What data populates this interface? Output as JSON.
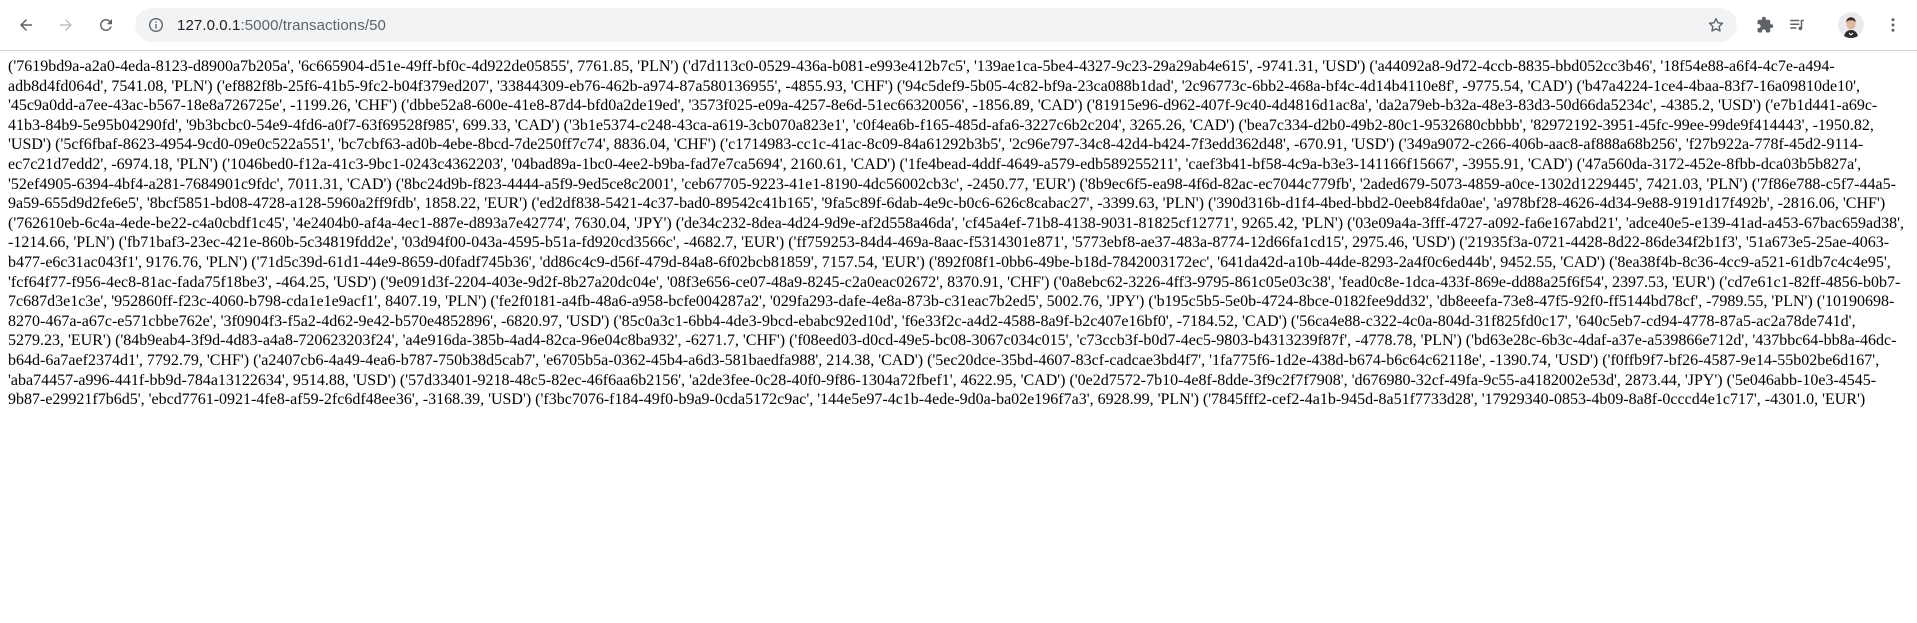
{
  "browser": {
    "url_host": "127.0.0.1",
    "url_path": ":5000/transactions/50",
    "icons": {
      "back": "arrow-left-icon",
      "forward": "arrow-right-icon",
      "reload": "reload-icon",
      "info": "info-icon",
      "star": "star-icon",
      "extensions": "puzzle-icon",
      "media": "media-control-icon",
      "menu": "kebab-menu-icon"
    }
  },
  "page": {
    "text": "('7619bd9a-a2a0-4eda-8123-d8900a7b205a', '6c665904-d51e-49ff-bf0c-4d922de05855', 7761.85, 'PLN') ('d7d113c0-0529-436a-b081-e993e412b7c5', '139ae1ca-5be4-4327-9c23-29a29ab4e615', -9741.31, 'USD') ('a44092a8-9d72-4ccb-8835-bbd052cc3b46', '18f54e88-a6f4-4c7e-a494-adb8d4fd064d', 7541.08, 'PLN') ('ef882f8b-25f6-41b5-9fc2-b04f379ed207', '33844309-eb76-462b-a974-87a580136955', -4855.93, 'CHF') ('94c5def9-5b05-4c82-bf9a-23ca088b1dad', '2c96773c-6bb2-468a-bf4c-4d14b4110e8f', -9775.54, 'CAD') ('b47a4224-1ce4-4baa-83f7-16a09810de10', '45c9a0dd-a7ee-43ac-b567-18e8a726725e', -1199.26, 'CHF') ('dbbe52a8-600e-41e8-87d4-bfd0a2de19ed', '3573f025-e09a-4257-8e6d-51ec66320056', -1856.89, 'CAD') ('81915e96-d962-407f-9c40-4d4816d1ac8a', 'da2a79eb-b32a-48e3-83d3-50d66da5234c', -4385.2, 'USD') ('e7b1d441-a69c-41b3-84b9-5e95b04290fd', '9b3bcbc0-54e9-4fd6-a0f7-63f69528f985', 699.33, 'CAD') ('3b1e5374-c248-43ca-a619-3cb070a823e1', 'c0f4ea6b-f165-485d-afa6-3227c6b2c204', 3265.26, 'CAD') ('bea7c334-d2b0-49b2-80c1-9532680cbbbb', '82972192-3951-45fc-99ee-99de9f414443', -1950.82, 'USD') ('5cf6fbaf-8623-4954-9cd0-09e0c522a551', 'bc7cbf63-ad0b-4ebe-8bcd-7de250ff7c74', 8836.04, 'CHF') ('c1714983-cc1c-41ac-8c09-84a61292b3b5', '2c96e797-34c8-42d4-b424-7f3edd362d48', -670.91, 'USD') ('349a9072-c266-406b-aac8-af888a68b256', 'f27b922a-778f-45d2-9114-ec7c21d7edd2', -6974.18, 'PLN') ('1046bed0-f12a-41c3-9bc1-0243c4362203', '04bad89a-1bc0-4ee2-b9ba-fad7e7ca5694', 2160.61, 'CAD') ('1fe4bead-4ddf-4649-a579-edb589255211', 'caef3b41-bf58-4c9a-b3e3-141166f15667', -3955.91, 'CAD') ('47a560da-3172-452e-8fbb-dca03b5b827a', '52ef4905-6394-4bf4-a281-7684901c9fdc', 7011.31, 'CAD') ('8bc24d9b-f823-4444-a5f9-9ed5ce8c2001', 'ceb67705-9223-41e1-8190-4dc56002cb3c', -2450.77, 'EUR') ('8b9ec6f5-ea98-4f6d-82ac-ec7044c779fb', '2aded679-5073-4859-a0ce-1302d1229445', 7421.03, 'PLN') ('7f86e788-c5f7-44a5-9a59-655d9d2fe6e5', '8bcf5851-bd08-4728-a128-5960a2ff9fdb', 1858.22, 'EUR') ('ed2df838-5421-4c37-bad0-89542c41b165', '9fa5c89f-6dab-4e9c-b0c6-626c8cabac27', -3399.63, 'PLN') ('390d316b-d1f4-4bed-bbd2-0eeb84fda0ae', 'a978bf28-4626-4d34-9e88-9191d17f492b', -2816.06, 'CHF') ('762610eb-6c4a-4ede-be22-c4a0cbdf1c45', '4e2404b0-af4a-4ec1-887e-d893a7e42774', 7630.04, 'JPY') ('de34c232-8dea-4d24-9d9e-af2d558a46da', 'cf45a4ef-71b8-4138-9031-81825cf12771', 9265.42, 'PLN') ('03e09a4a-3fff-4727-a092-fa6e167abd21', 'adce40e5-e139-41ad-a453-67bac659ad38', -1214.66, 'PLN') ('fb71baf3-23ec-421e-860b-5c34819fdd2e', '03d94f00-043a-4595-b51a-fd920cd3566c', -4682.7, 'EUR') ('ff759253-84d4-469a-8aac-f5314301e871', '5773ebf8-ae37-483a-8774-12d66fa1cd15', 2975.46, 'USD') ('21935f3a-0721-4428-8d22-86de34f2b1f3', '51a673e5-25ae-4063-b477-e6c31ac043f1', 9176.76, 'PLN') ('71d5c39d-61d1-44e9-8659-d0fadf745b36', 'dd86c4c9-d56f-479d-84a8-6f02bcb81859', 7157.54, 'EUR') ('892f08f1-0bb6-49be-b18d-7842003172ec', '641da42d-a10b-44de-8293-2a4f0c6ed44b', 9452.55, 'CAD') ('8ea38f4b-8c36-4cc9-a521-61db7c4c4e95', 'fcf64f77-f956-4ec8-81ac-fada75f18be3', -464.25, 'USD') ('9e091d3f-2204-403e-9d2f-8b27a20dc04e', '08f3e656-ce07-48a9-8245-c2a0eac02672', 8370.91, 'CHF') ('0a8ebc62-3226-4ff3-9795-861c05e03c38', 'fead0c8e-1dca-433f-869e-dd88a25f6f54', 2397.53, 'EUR') ('cd7e61c1-82ff-4856-b0b7-7c687d3e1c3e', '952860ff-f23c-4060-b798-cda1e1e9acf1', 8407.19, 'PLN') ('fe2f0181-a4fb-48a6-a958-bcfe004287a2', '029fa293-dafe-4e8a-873b-c31eac7b2ed5', 5002.76, 'JPY') ('b195c5b5-5e0b-4724-8bce-0182fee9dd32', 'db8eeefa-73e8-47f5-92f0-ff5144bd78cf', -7989.55, 'PLN') ('10190698-8270-467a-a67c-e571cbbe762e', '3f0904f3-f5a2-4d62-9e42-b570e4852896', -6820.97, 'USD') ('85c0a3c1-6bb4-4de3-9bcd-ebabc92ed10d', 'f6e33f2c-a4d2-4588-8a9f-b2c407e16bf0', -7184.52, 'CAD') ('56ca4e88-c322-4c0a-804d-31f825fd0c17', '640c5eb7-cd94-4778-87a5-ac2a78de741d', 5279.23, 'EUR') ('84b9eab4-3f9d-4d83-a4a8-720623203f24', 'a4e916da-385b-4ad4-82ca-96e04c8ba932', -6271.7, 'CHF') ('f08eed03-d0cd-49e5-bc08-3067c034c015', 'c73ccb3f-b0d7-4ec5-9803-b4313239f87f', -4778.78, 'PLN') ('bd63e28c-6b3c-4daf-a37e-a539866e712d', '437bbc64-bb8a-46dc-b64d-6a7aef2374d1', 7792.79, 'CHF') ('a2407cb6-4a49-4ea6-b787-750b38d5cab7', 'e6705b5a-0362-45b4-a6d3-581baedfa988', 214.38, 'CAD') ('5ec20dce-35bd-4607-83cf-cadcae3bd4f7', '1fa775f6-1d2e-438d-b674-b6c64c62118e', -1390.74, 'USD') ('f0ffb9f7-bf26-4587-9e14-55b02be6d167', 'aba74457-a996-441f-bb9d-784a13122634', 9514.88, 'USD') ('57d33401-9218-48c5-82ec-46f6aa6b2156', 'a2de3fee-0c28-40f0-9f86-1304a72fbef1', 4622.95, 'CAD') ('0e2d7572-7b10-4e8f-8dde-3f9c2f7f7908', 'd676980-32cf-49fa-9c55-a4182002e53d', 2873.44, 'JPY') ('5e046abb-10e3-4545-9b87-e29921f7b6d5', 'ebcd7761-0921-4fe8-af59-2fc6df48ee36', -3168.39, 'USD') ('f3bc7076-f184-49f0-b9a9-0cda5172c9ac', '144e5e97-4c1b-4ede-9d0a-ba02e196f7a3', 6928.99, 'PLN') ('7845fff2-cef2-4a1b-945d-8a51f7733d28', '17929340-0853-4b09-8a8f-0cccd4e1c717', -4301.0, 'EUR')"
  }
}
